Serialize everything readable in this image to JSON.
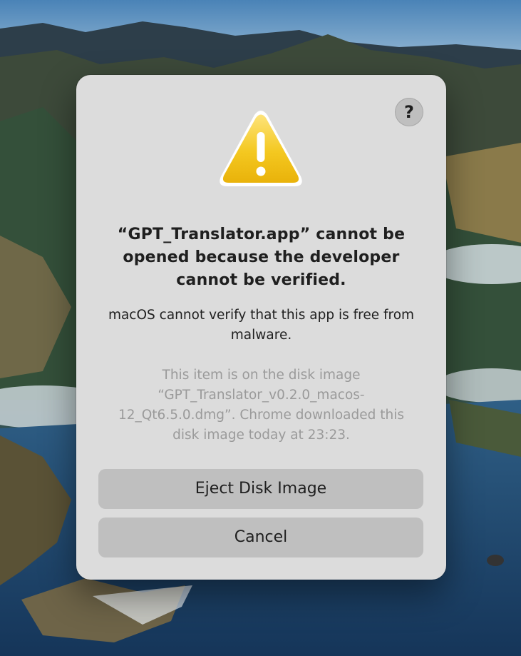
{
  "dialog": {
    "title": "“GPT_Translator.app” cannot be opened because the developer cannot be verified.",
    "message": "macOS cannot verify that this app is free from malware.",
    "info": "This item is on the disk image “GPT_Translator_v0.2.0_macos-12_Qt6.5.0.dmg”. Chrome downloaded this disk image today at 23:23.",
    "help_label": "?",
    "icon": "warning-icon",
    "buttons": {
      "eject": "Eject Disk Image",
      "cancel": "Cancel"
    }
  },
  "colors": {
    "dialog_background": "#dcdcdc",
    "button_background": "#bfbfbf",
    "warning_yellow": "#f2c418",
    "secondary_text": "#9a9a9a"
  }
}
